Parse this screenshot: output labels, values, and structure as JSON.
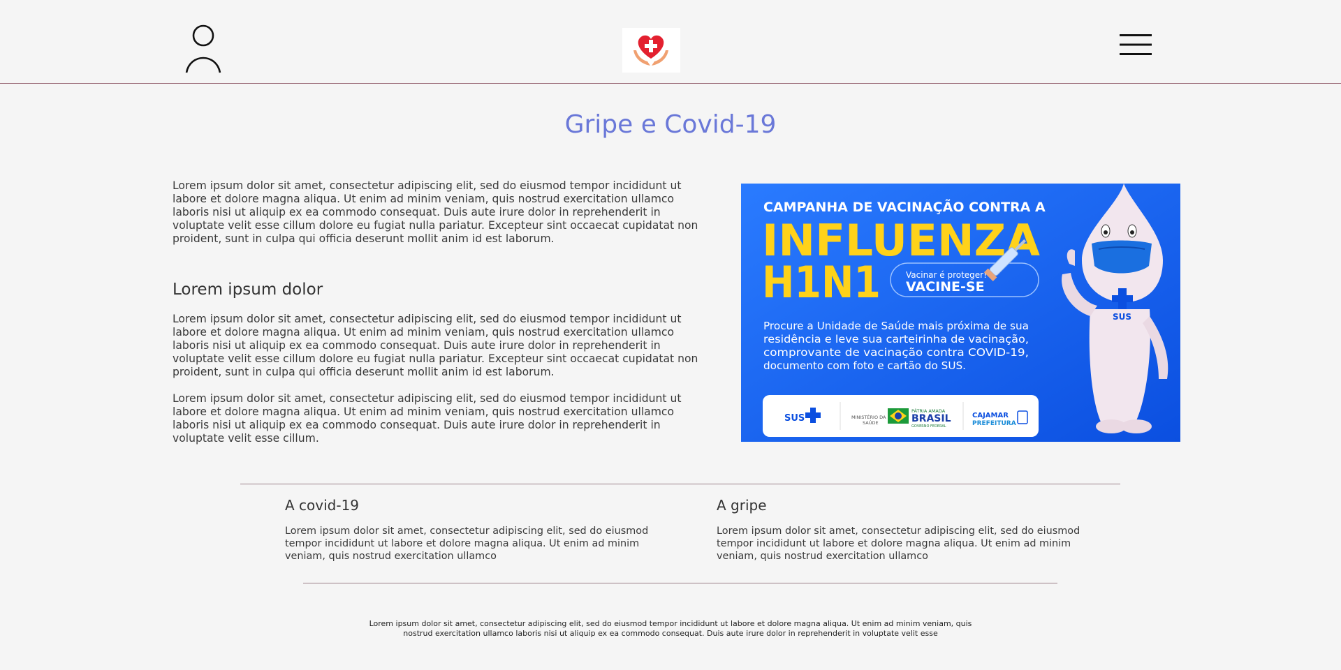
{
  "header": {
    "user_icon": "user-icon",
    "logo_icon": "heart-hands-logo-icon",
    "menu_icon": "hamburger-menu-icon"
  },
  "page": {
    "title": "Gripe e Covid-19",
    "intro": "Lorem ipsum dolor sit amet, consectetur adipiscing elit, sed do eiusmod tempor incididunt ut labore et dolore magna aliqua. Ut enim ad minim veniam, quis nostrud exercitation ullamco laboris nisi ut aliquip ex ea commodo consequat. Duis aute irure dolor in reprehenderit in voluptate velit esse cillum dolore eu fugiat nulla pariatur. Excepteur sint occaecat cupidatat non proident, sunt in culpa qui officia deserunt mollit anim id est laborum.",
    "subheading": "Lorem ipsum dolor",
    "para2": "Lorem ipsum dolor sit amet, consectetur adipiscing elit, sed do eiusmod tempor incididunt ut labore et dolore magna aliqua. Ut enim ad minim veniam, quis nostrud exercitation ullamco laboris nisi ut aliquip ex ea commodo consequat. Duis aute irure dolor in reprehenderit in voluptate velit esse cillum dolore eu fugiat nulla pariatur. Excepteur sint occaecat cupidatat non proident, sunt in culpa qui officia deserunt mollit anim id est laborum.",
    "para3": "Lorem ipsum dolor sit amet, consectetur adipiscing elit, sed do eiusmod tempor incididunt ut labore et dolore magna aliqua. Ut enim ad minim veniam, quis nostrud exercitation ullamco laboris nisi ut aliquip ex ea commodo consequat. Duis aute irure dolor in reprehenderit in voluptate velit esse cillum."
  },
  "banner": {
    "headline": "CAMPANHA DE VACINAÇÃO CONTRA A",
    "big1": "INFLUENZA",
    "big2": "H1N1",
    "pill_small": "Vacinar é proteger!",
    "pill_big": "VACINE-SE",
    "body1": "Procure a Unidade de Saúde mais próxima de sua",
    "body2": "residência e leve sua carteirinha de vacinação,",
    "body3": "comprovante de vacinação contra COVID-19,",
    "body4": "documento com foto e cartão do SUS.",
    "logo_sus": "SUS",
    "logo_ministerio1": "MINISTÉRIO DA",
    "logo_ministerio2": "SAÚDE",
    "logo_brasil_small": "PÁTRIA AMADA",
    "logo_brasil": "BRASIL",
    "logo_brasil_sub": "GOVERNO FEDERAL",
    "logo_cajamar1": "CAJAMAR",
    "logo_cajamar2": "PREFEITURA",
    "mascot_badge": "SUS",
    "colors": {
      "blue": "#1a6cf0",
      "yellow": "#ffd21a"
    }
  },
  "cards": [
    {
      "title": "A covid-19",
      "text": "Lorem ipsum dolor sit amet, consectetur adipiscing elit, sed do eiusmod tempor incididunt ut labore et dolore magna aliqua. Ut enim ad minim veniam, quis nostrud exercitation ullamco"
    },
    {
      "title": "A gripe",
      "text": "Lorem ipsum dolor sit amet, consectetur adipiscing elit, sed do eiusmod tempor incididunt ut labore et dolore magna aliqua. Ut enim ad minim veniam, quis nostrud exercitation ullamco"
    }
  ],
  "footer": {
    "text": "Lorem ipsum dolor sit amet, consectetur adipiscing elit, sed do eiusmod tempor incididunt ut labore et dolore magna aliqua. Ut enim ad minim veniam, quis nostrud exercitation ullamco laboris nisi ut aliquip ex ea commodo consequat. Duis aute irure dolor in reprehenderit in voluptate velit esse"
  }
}
